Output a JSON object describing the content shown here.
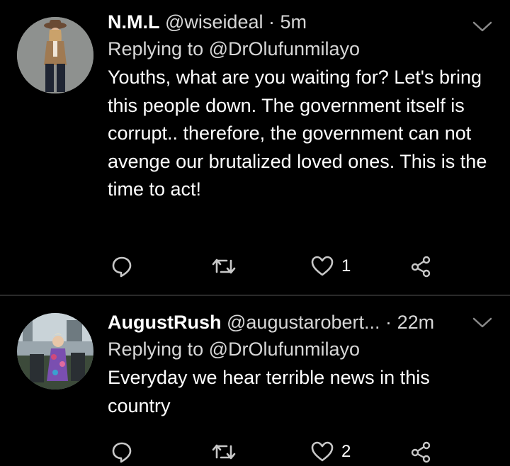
{
  "tweets": [
    {
      "name": "N.M.L",
      "handle": "@wiseideal",
      "separator": "·",
      "time": "5m",
      "replying_to": "Replying to @DrOlufunmilayo",
      "text": "Youths, what are you waiting for? Let's bring this people down. The government itself is corrupt.. therefore, the government can not avenge our brutalized loved ones. This is the time to act!",
      "reply_count": "",
      "retweet_count": "",
      "like_count": "1"
    },
    {
      "name": "AugustRush",
      "handle": "@augustarobert...",
      "separator": "·",
      "time": "22m",
      "replying_to": "Replying to @DrOlufunmilayo",
      "text": "Everyday we hear terrible news in this country",
      "reply_count": "",
      "retweet_count": "",
      "like_count": "2"
    }
  ],
  "icons": {
    "reply": "reply-icon",
    "retweet": "retweet-icon",
    "like": "heart-icon",
    "share": "share-icon",
    "more": "chevron-down-icon"
  },
  "colors": {
    "background": "#000000",
    "text": "#ffffff",
    "secondary": "#d7d7d7",
    "icon": "#c8c8c8",
    "divider": "#2a2a2a"
  }
}
